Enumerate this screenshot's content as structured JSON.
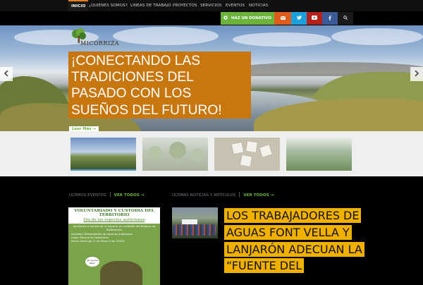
{
  "nav": {
    "items": [
      {
        "label": "INICIO",
        "active": true
      },
      {
        "label": "¿QUIENES SOMOS?"
      },
      {
        "label": "LINEAS DE TRABAJO"
      },
      {
        "label": "PROYECTOS"
      },
      {
        "label": "SERVICIOS"
      },
      {
        "label": "EVENTOS"
      },
      {
        "label": "NOTICIAS"
      }
    ]
  },
  "actions": {
    "donate_label": "HAZ UN DONATIVO",
    "mail_icon": "mail-icon",
    "twitter_icon": "twitter-icon",
    "youtube_icon": "youtube-icon",
    "facebook_icon": "facebook-icon",
    "search_icon": "search-icon"
  },
  "hero": {
    "brand": "MICORRIZA",
    "title": "¡CONECTANDO LAS TRADICIONES DEL PASADO CON LOS SUEÑOS DEL FUTURO!",
    "read_more": "Leer Más →",
    "prev_icon": "chevron-left-icon",
    "next_icon": "chevron-right-icon"
  },
  "events": {
    "heading": "ÚLTIMOS EVENTOS",
    "more": "VER TODOS →",
    "poster": {
      "title": "VOLUNTARIADO Y CUSTODIA DEL TERRITORIO",
      "subtitle": "Día de las especies autóctonas",
      "lead": "Ayúdanos a conservar el espacio en custodia del Bosque de Valdemorar",
      "lines": [
        "Actividad: Reforestación de especies autóctonas",
        "Lugar: Bosque de Valdemorar",
        "Fecha: Domingo 11 de Marzo a las 10:00h"
      ],
      "bubble": "¡No puedes faltar!"
    }
  },
  "news": {
    "heading": "ÚLTIMAS NOTICIAS Y ARTÍCULOS",
    "more": "VER TODOS →",
    "headline": "LOS TRABAJADORES DE AGUAS FONT VELLA Y LANJARÓN ADECUAN LA “FUENTE DEL"
  },
  "colors": {
    "accent_green": "#6bb33a",
    "caption_orange": "#c8770f",
    "headline_yellow": "#f0b000",
    "active_border": "#e87c1e"
  }
}
